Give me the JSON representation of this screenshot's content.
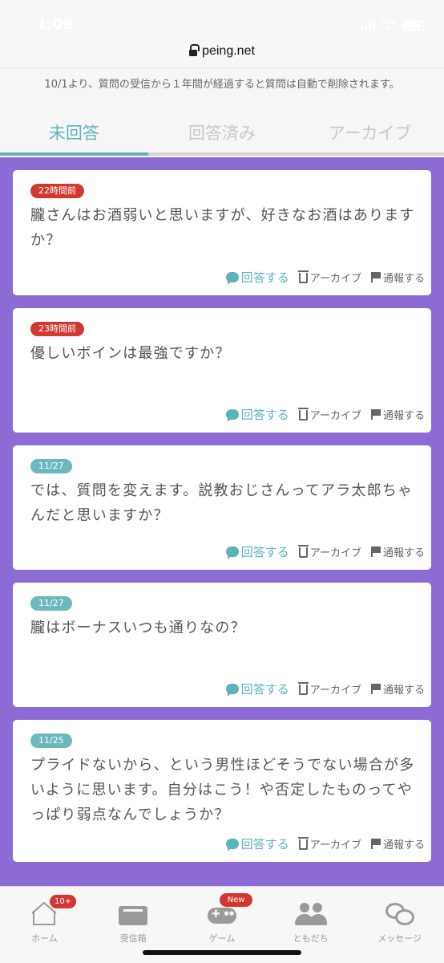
{
  "status": {
    "time": "1:09"
  },
  "browser": {
    "url": "peing.net"
  },
  "notice": "10/1より、質問の受信から１年間が経過すると質問は自動で削除されます。",
  "tabs": [
    {
      "label": "未回答",
      "active": true
    },
    {
      "label": "回答済み",
      "active": false
    },
    {
      "label": "アーカイブ",
      "active": false
    }
  ],
  "actions": {
    "answer": "回答する",
    "archive": "アーカイブ",
    "report": "通報する"
  },
  "questions": [
    {
      "time": "22時間前",
      "badge_color": "#d23830",
      "text": "朧さんはお酒弱いと思いますが、好きなお酒はありますか？"
    },
    {
      "time": "23時間前",
      "badge_color": "#d23830",
      "text": "優しいボインは最強ですか？"
    },
    {
      "time": "11/27",
      "badge_color": "#6cb8bd",
      "text": "では、質問を変えます。説教おじさんってアラ太郎ちゃんだと思いますか？"
    },
    {
      "time": "11/27",
      "badge_color": "#6cb8bd",
      "text": "朧はボーナスいつも通りなの？"
    },
    {
      "time": "11/25",
      "badge_color": "#6cb8bd",
      "text": "プライドないから、という男性ほどそうでない場合が多いように思います。自分はこう！や否定したものってやっぱり弱点なんでしょうか？"
    }
  ],
  "nav": [
    {
      "label": "ホーム",
      "icon": "home-icon",
      "badge": "10+"
    },
    {
      "label": "受信箱",
      "icon": "inbox-icon"
    },
    {
      "label": "ゲーム",
      "icon": "gamepad-icon",
      "badge": "New"
    },
    {
      "label": "ともだち",
      "icon": "friends-icon"
    },
    {
      "label": "メッセージ",
      "icon": "chat-icon"
    }
  ],
  "colors": {
    "accent": "#5db3ba",
    "background": "#8c6bd4",
    "badge_red": "#d23830",
    "badge_teal": "#6cb8bd"
  }
}
